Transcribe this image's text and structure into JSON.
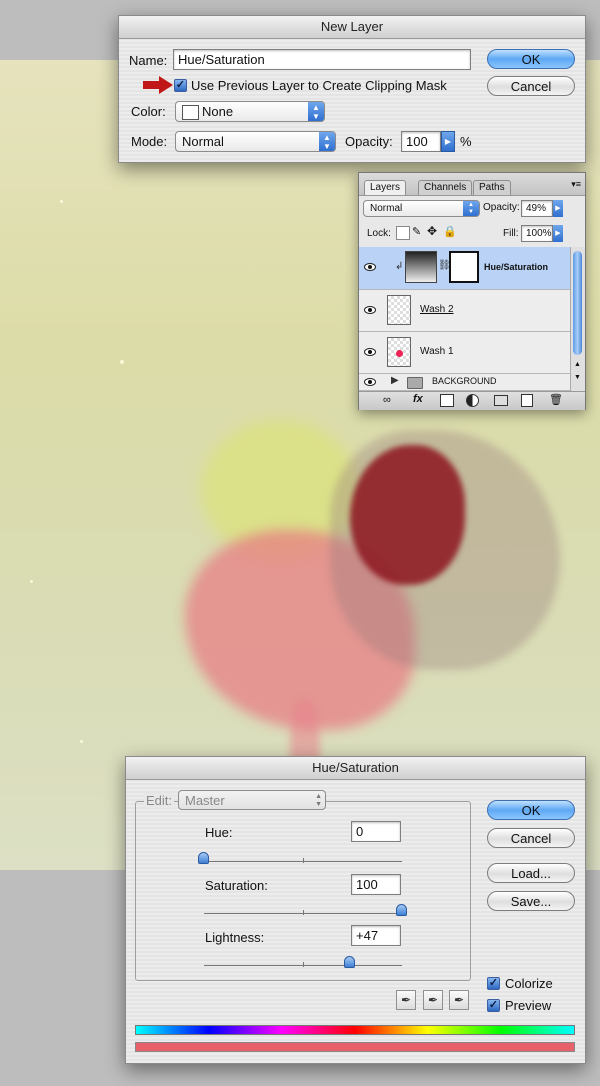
{
  "new_layer": {
    "title": "New Layer",
    "name_label": "Name:",
    "name_value": "Hue/Saturation",
    "clip_label": "Use Previous Layer to Create Clipping Mask",
    "color_label": "Color:",
    "color_value": "None",
    "mode_label": "Mode:",
    "mode_value": "Normal",
    "opacity_label": "Opacity:",
    "opacity_value": "100",
    "opacity_unit": "%",
    "ok_label": "OK",
    "cancel_label": "Cancel"
  },
  "layers_panel": {
    "tabs": [
      "Layers",
      "Channels",
      "Paths"
    ],
    "blend_mode": "Normal",
    "opacity_label": "Opacity:",
    "opacity_value": "49%",
    "lock_label": "Lock:",
    "fill_label": "Fill:",
    "fill_value": "100%",
    "layers": [
      {
        "name": "Hue/Saturation",
        "selected": true
      },
      {
        "name": "Wash 2",
        "selected": false
      },
      {
        "name": "Wash 1",
        "selected": false
      },
      {
        "name": "BACKGROUND",
        "selected": false
      }
    ],
    "fx_label": "fx"
  },
  "hue_sat": {
    "title": "Hue/Saturation",
    "edit_label": "Edit:",
    "edit_value": "Master",
    "hue_label": "Hue:",
    "hue_value": "0",
    "saturation_label": "Saturation:",
    "saturation_value": "100",
    "lightness_label": "Lightness:",
    "lightness_value": "+47",
    "ok_label": "OK",
    "cancel_label": "Cancel",
    "load_label": "Load...",
    "save_label": "Save...",
    "colorize_label": "Colorize",
    "preview_label": "Preview"
  },
  "colors": {
    "accent": "#3b7fd6",
    "result_bar": "#e8616a",
    "arrow": "#c01818"
  }
}
